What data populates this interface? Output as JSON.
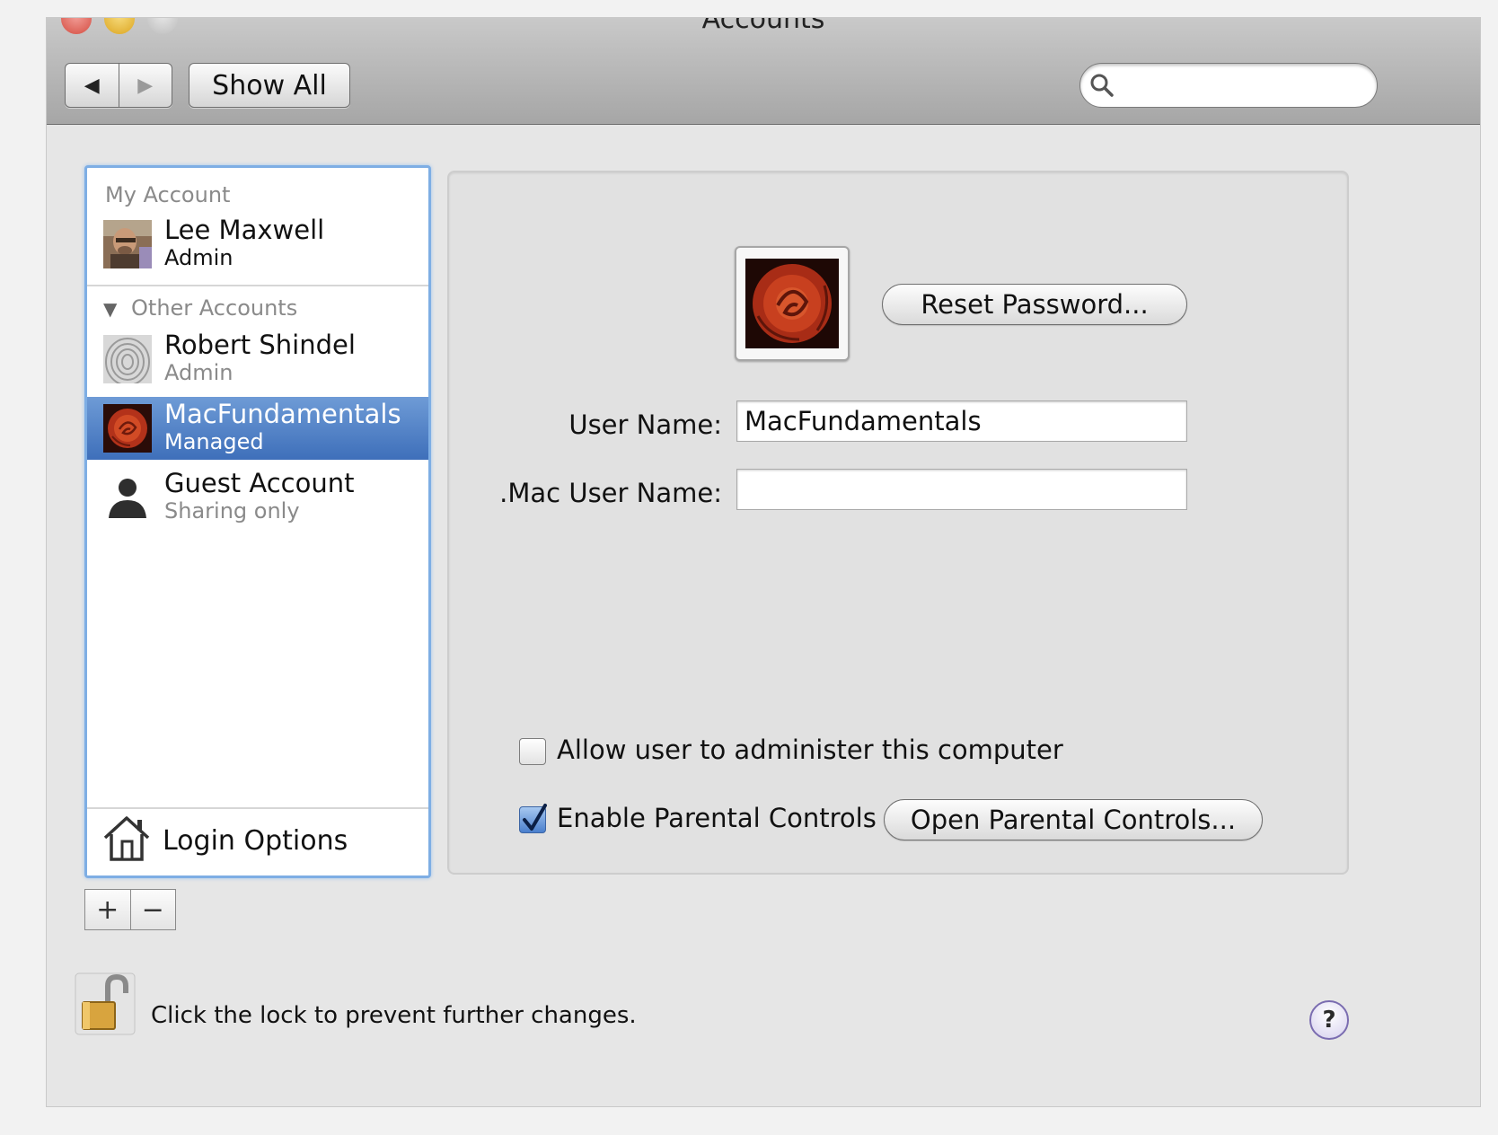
{
  "window": {
    "title": "Accounts"
  },
  "toolbar": {
    "back_glyph": "◀",
    "forward_glyph": "▶",
    "show_all_label": "Show All",
    "search_value": ""
  },
  "sidebar": {
    "my_account_header": "My Account",
    "other_accounts_header": "Other Accounts",
    "accounts": [
      {
        "name": "Lee Maxwell",
        "role": "Admin",
        "avatar": "photo-avatar"
      },
      {
        "name": "Robert Shindel",
        "role": "Admin",
        "avatar": "fingerprint-avatar"
      },
      {
        "name": "MacFundamentals",
        "role": "Managed",
        "avatar": "rose-avatar",
        "selected": true
      },
      {
        "name": "Guest Account",
        "role": "Sharing only",
        "avatar": "person-silhouette-icon"
      }
    ],
    "login_options_label": "Login Options",
    "add_glyph": "+",
    "remove_glyph": "−"
  },
  "detail": {
    "reset_password_label": "Reset Password...",
    "user_name_label": "User Name:",
    "user_name_value": "MacFundamentals",
    "mac_user_name_label": ".Mac User Name:",
    "mac_user_name_value": "",
    "allow_admin_label": "Allow user to administer this computer",
    "allow_admin_checked": false,
    "parental_controls_label": "Enable Parental Controls",
    "parental_controls_checked": true,
    "open_parental_controls_label": "Open Parental Controls..."
  },
  "footer": {
    "lock_text": "Click the lock to prevent further changes.",
    "help_glyph": "?"
  },
  "colors": {
    "selection": "#3e6fba",
    "list_focus_ring": "#7eaee4"
  }
}
